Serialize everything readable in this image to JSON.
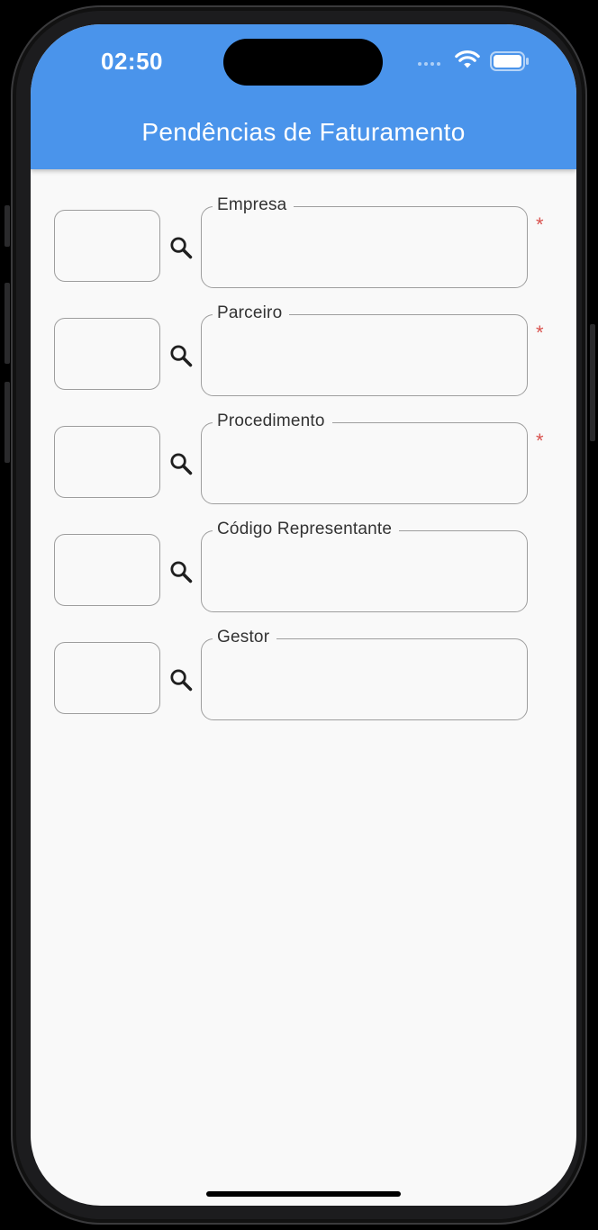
{
  "status_bar": {
    "time": "02:50",
    "wifi_icon": "wifi-icon",
    "battery_icon": "battery-icon"
  },
  "app_bar": {
    "title": "Pendências de Faturamento",
    "color": "#4a94eb"
  },
  "form": {
    "fields": [
      {
        "label": "Empresa",
        "code_value": "",
        "value": "",
        "required": true,
        "required_mark": "*"
      },
      {
        "label": "Parceiro",
        "code_value": "",
        "value": "",
        "required": true,
        "required_mark": "*"
      },
      {
        "label": "Procedimento",
        "code_value": "",
        "value": "",
        "required": true,
        "required_mark": "*"
      },
      {
        "label": "Código Representante",
        "code_value": "",
        "value": "",
        "required": false,
        "required_mark": ""
      },
      {
        "label": "Gestor",
        "code_value": "",
        "value": "",
        "required": false,
        "required_mark": ""
      }
    ],
    "search_icon": "search-icon",
    "required_color": "#d9534f"
  }
}
